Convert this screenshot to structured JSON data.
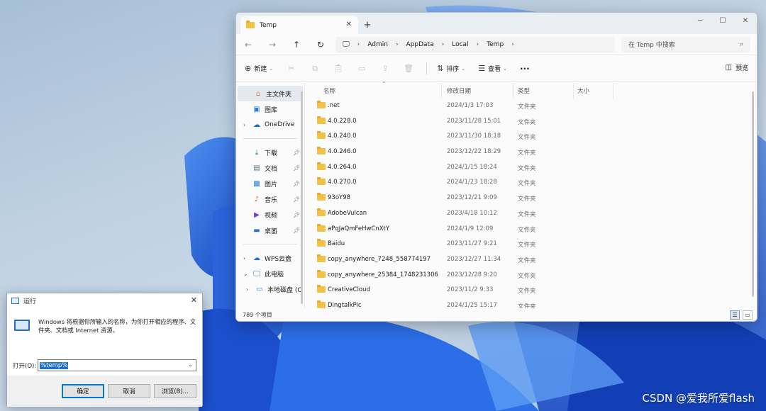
{
  "explorer": {
    "tab_title": "Temp",
    "new_tab": "+",
    "breadcrumbs": [
      "Admin",
      "AppData",
      "Local",
      "Temp"
    ],
    "search_placeholder": "在 Temp 中搜索",
    "toolbar": {
      "new_label": "新建",
      "sort_label": "排序",
      "view_label": "查看",
      "more": "···",
      "preview_label": "预览"
    },
    "nav": {
      "items": [
        {
          "label": "主文件夹",
          "icon": "home-icon"
        },
        {
          "label": "图库",
          "icon": "gallery-icon"
        },
        {
          "label": "OneDrive",
          "icon": "cloud-icon"
        },
        {
          "label": "下载",
          "icon": "download-icon"
        },
        {
          "label": "文档",
          "icon": "document-icon"
        },
        {
          "label": "图片",
          "icon": "picture-icon"
        },
        {
          "label": "音乐",
          "icon": "music-icon"
        },
        {
          "label": "视频",
          "icon": "video-icon"
        },
        {
          "label": "桌面",
          "icon": "desktop-icon"
        },
        {
          "label": "WPS云盘",
          "icon": "wps-cloud-icon"
        },
        {
          "label": "此电脑",
          "icon": "pc-icon"
        },
        {
          "label": "本地磁盘 (C:)",
          "icon": "drive-icon"
        }
      ]
    },
    "columns": {
      "name": "名称",
      "modified": "修改日期",
      "type": "类型",
      "size": "大小"
    },
    "files": [
      {
        "name": ".net",
        "date": "2024/1/3 17:03",
        "type": "文件夹"
      },
      {
        "name": "4.0.228.0",
        "date": "2023/11/28 15:01",
        "type": "文件夹"
      },
      {
        "name": "4.0.240.0",
        "date": "2023/11/30 18:18",
        "type": "文件夹"
      },
      {
        "name": "4.0.246.0",
        "date": "2023/12/22 18:29",
        "type": "文件夹"
      },
      {
        "name": "4.0.264.0",
        "date": "2024/1/15 18:24",
        "type": "文件夹"
      },
      {
        "name": "4.0.270.0",
        "date": "2024/1/23 18:28",
        "type": "文件夹"
      },
      {
        "name": "93oY98",
        "date": "2023/12/21 9:09",
        "type": "文件夹"
      },
      {
        "name": "AdobeVulcan",
        "date": "2023/4/18 10:12",
        "type": "文件夹"
      },
      {
        "name": "aPqJaQmFeHwCnXtY",
        "date": "2024/1/9 12:09",
        "type": "文件夹"
      },
      {
        "name": "Baidu",
        "date": "2023/11/27 9:21",
        "type": "文件夹"
      },
      {
        "name": "copy_anywhere_7248_558774197",
        "date": "2023/12/27 11:34",
        "type": "文件夹"
      },
      {
        "name": "copy_anywhere_25384_1748231306",
        "date": "2023/12/28 9:20",
        "type": "文件夹"
      },
      {
        "name": "CreativeCloud",
        "date": "2023/11/2 9:33",
        "type": "文件夹"
      },
      {
        "name": "DingtalkPic",
        "date": "2024/1/25 15:17",
        "type": "文件夹"
      }
    ],
    "status": "789 个项目"
  },
  "run": {
    "title": "运行",
    "description": "Windows 将根据你所输入的名称，为你打开相应的程序、文件夹、文档或 Internet 资源。",
    "open_label": "打开(O):",
    "input_value": "%temp%",
    "ok": "确定",
    "cancel": "取消",
    "browse": "浏览(B)..."
  },
  "watermark": "CSDN @爱我所爱flash"
}
